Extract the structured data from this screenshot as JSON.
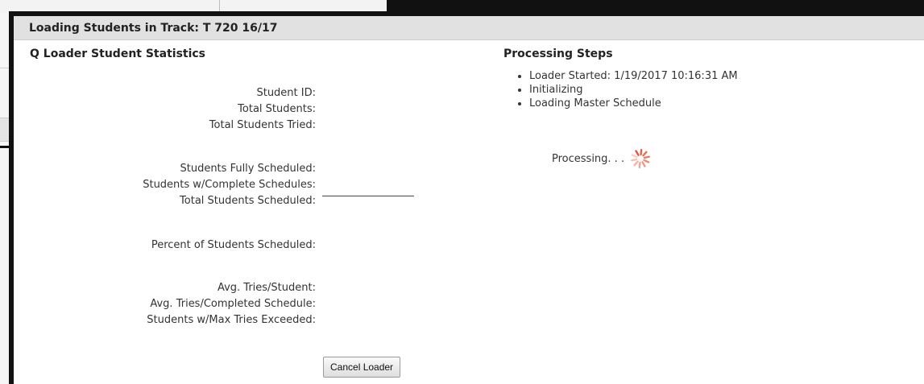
{
  "dialog": {
    "title": "Loading Students in Track: T 720 16/17"
  },
  "statistics": {
    "title": "Q Loader Student Statistics",
    "rows": [
      {
        "label": "Student ID:"
      },
      {
        "label": "Total Students:"
      },
      {
        "label": "Total Students Tried:"
      },
      {
        "label": "Students Fully Scheduled:"
      },
      {
        "label": "Students w/Complete Schedules:"
      },
      {
        "label": "Total Students Scheduled:"
      },
      {
        "label": "Percent of Students Scheduled:"
      },
      {
        "label": "Avg. Tries/Student:"
      },
      {
        "label": "Avg. Tries/Completed Schedule:"
      },
      {
        "label": "Students w/Max Tries Exceeded:"
      }
    ],
    "cancel_label": "Cancel Loader"
  },
  "processing": {
    "title": "Processing Steps",
    "steps": [
      "Loader Started: 1/19/2017 10:16:31 AM",
      "Initializing",
      "Loading Master Schedule"
    ],
    "status_text": "Processing. . .",
    "spinner_icon": "loading-spinner-icon",
    "spinner_color": "#e0573a"
  },
  "colors": {
    "dialog_border": "#111111",
    "header_bg": "#e1e1e1"
  }
}
